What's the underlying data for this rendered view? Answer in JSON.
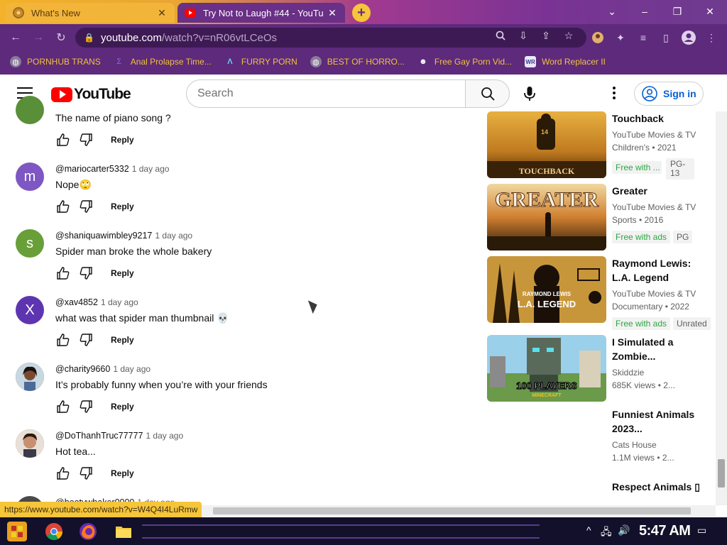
{
  "browser": {
    "tabs": [
      {
        "title": "What's New",
        "active": false
      },
      {
        "title": "Try Not to Laugh #44 - YouTu",
        "active": true
      }
    ],
    "new_tab": "+",
    "window_controls": {
      "dropdown": "⌄",
      "minimize": "–",
      "restore": "❐",
      "close": "✕"
    },
    "url_host": "youtube.com",
    "url_path": "/watch?v=nR06vtLCeOs",
    "bookmarks": [
      {
        "label": "PORNHUB TRANS",
        "icon": "globe-icon"
      },
      {
        "label": "Anal Prolapse Time...",
        "icon": "bracket-icon"
      },
      {
        "label": "FURRY PORN",
        "icon": "lambda-icon"
      },
      {
        "label": "BEST OF HORRO...",
        "icon": "globe-icon"
      },
      {
        "label": "Free Gay Porn Vid...",
        "icon": "mask-icon"
      },
      {
        "label": "Word Replacer II",
        "icon": "wr-icon"
      }
    ],
    "status_url": "https://www.youtube.com/watch?v=W4Q4I4LuRmw"
  },
  "youtube": {
    "logo_text": "YouTube",
    "search_placeholder": "Search",
    "sign_in": "Sign in"
  },
  "comments": [
    {
      "author": "",
      "time": "",
      "text": "The name of piano song ?",
      "avatar_letter": "",
      "avatar_color": "#5a8f3a",
      "reply": "Reply"
    },
    {
      "author": "@mariocarter5332",
      "time": "1 day ago",
      "text": "Nope",
      "emoji": "🙄",
      "avatar_letter": "m",
      "avatar_color": "#7e57c2",
      "reply": "Reply"
    },
    {
      "author": "@shaniquawimbley9217",
      "time": "1 day ago",
      "text": "Spider man broke the whole bakery",
      "avatar_letter": "s",
      "avatar_color": "#689f38",
      "reply": "Reply"
    },
    {
      "author": "@xav4852",
      "time": "1 day ago",
      "text": "what was that spider man thumbnail",
      "emoji": "💀",
      "avatar_letter": "X",
      "avatar_color": "#5e35b1",
      "reply": "Reply"
    },
    {
      "author": "@charity9660",
      "time": "1 day ago",
      "text": "It’s probably funny when you’re with your friends",
      "avatar_letter": "",
      "avatar_color": "#3b2a2a",
      "reply": "Reply"
    },
    {
      "author": "@DoThanhTruc77777",
      "time": "1 day ago",
      "text": "Hot tea...",
      "avatar_letter": "",
      "avatar_color": "#6a5040",
      "reply": "Reply"
    },
    {
      "author": "@bootywhaker0000",
      "time": "1 day ago",
      "text": "",
      "avatar_letter": "",
      "avatar_color": "#4a4a4a",
      "reply": "Reply"
    }
  ],
  "sidebar_videos": [
    {
      "title": "Touchback",
      "channel": "YouTube Movies & TV",
      "meta": "Children's • 2021",
      "badge": "Free with ...",
      "rating": "PG-13",
      "thumb_text": "TOUCHBACK",
      "thumb_colors": [
        "#d8a23a",
        "#6a3a10"
      ]
    },
    {
      "title": "Greater",
      "channel": "YouTube Movies & TV",
      "meta": "Sports • 2016",
      "badge": "Free with ads",
      "rating": "PG",
      "thumb_text": "GREATER",
      "thumb_colors": [
        "#e0a040",
        "#3a2410"
      ]
    },
    {
      "title": "Raymond Lewis: L.A. Legend",
      "channel": "YouTube Movies & TV",
      "meta": "Documentary • 2022",
      "badge": "Free with ads",
      "rating": "Unrated",
      "thumb_text": "RAYMOND LEWIS L.A. LEGEND",
      "thumb_colors": [
        "#c89a3a",
        "#2a1a08"
      ]
    },
    {
      "title": "I Simulated a Zombie...",
      "channel": "Skiddzie",
      "meta": "685K views  • 2...",
      "badge": "",
      "rating": "",
      "thumb_text": "100 PLAYERS",
      "thumb_colors": [
        "#8ac8e8",
        "#5a8a3a"
      ]
    },
    {
      "title": "Funniest Animals 2023...",
      "channel": "Cats House",
      "meta": "1.1M views  • 2...",
      "badge": "",
      "rating": "",
      "thumb_text": "",
      "thumb_colors": [
        "#ffffff",
        "#ffffff"
      ]
    },
    {
      "title": "Respect Animals ▯",
      "channel": "",
      "meta": "",
      "badge": "",
      "rating": "",
      "thumb_text": "",
      "thumb_colors": [
        "#ffffff",
        "#ffffff"
      ]
    }
  ],
  "taskbar": {
    "clock": "5:47 AM"
  }
}
